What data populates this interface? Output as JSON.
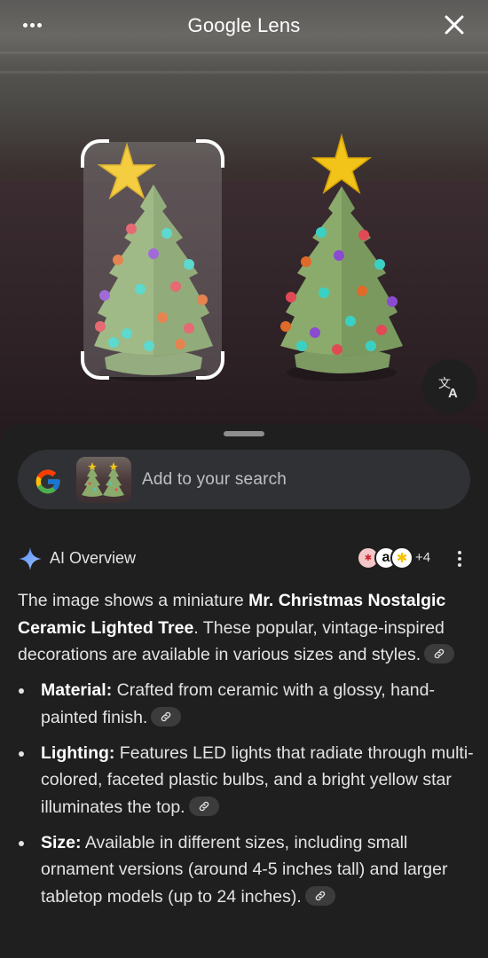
{
  "header": {
    "title": "Google Lens",
    "more_icon": "more-horiz-icon",
    "close_icon": "close-icon"
  },
  "photo": {
    "translate_icon": "translate-icon"
  },
  "search": {
    "placeholder": "Add to your search",
    "logo": "google-g-icon"
  },
  "ai_overview": {
    "label": "AI Overview",
    "sources_more": "+4",
    "intro_pre": "The image shows a miniature ",
    "intro_bold": "Mr. Christmas Nostalgic Ceramic Lighted Tree",
    "intro_post": ". These popular, vintage-inspired decorations are available in various sizes and styles.",
    "bullets": [
      {
        "label": "Material:",
        "text": " Crafted from ceramic with a glossy, hand-painted finish."
      },
      {
        "label": "Lighting:",
        "text": " Features LED lights that radiate through multi-colored, faceted plastic bulbs, and a bright yellow star illuminates the top."
      },
      {
        "label": "Size:",
        "text": " Available in different sizes, including small ornament versions (around 4-5 inches tall) and larger tabletop models (up to 24 inches)."
      }
    ]
  },
  "colors": {
    "background": "#1f1f1f",
    "search_bar": "#303134",
    "text": "#e3e3e3",
    "sparkle": "#4285f4"
  }
}
